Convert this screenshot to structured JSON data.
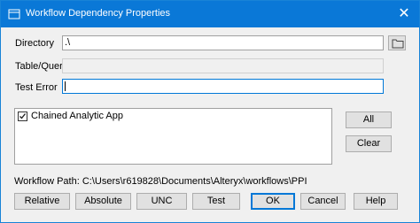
{
  "window": {
    "title": "Workflow Dependency Properties",
    "close_glyph": "✕"
  },
  "fields": {
    "directory_label": "Directory",
    "directory_value": ".\\",
    "table_query_label": "Table/Query",
    "table_query_value": "",
    "test_error_label": "Test Error",
    "test_error_value": ""
  },
  "list": {
    "items": [
      {
        "label": "Chained Analytic App",
        "checked": true
      }
    ]
  },
  "side_buttons": {
    "all_label": "All",
    "clear_label": "Clear"
  },
  "workflow_path": {
    "text": "Workflow Path: C:\\Users\\r619828\\Documents\\Alteryx\\workflows\\PPI"
  },
  "bottom_buttons": {
    "relative": "Relative",
    "absolute": "Absolute",
    "unc": "UNC",
    "test": "Test",
    "ok": "OK",
    "cancel": "Cancel",
    "help": "Help"
  },
  "colors": {
    "titlebar": "#0a78d7",
    "dialog_bg": "#f0f0f0",
    "accent": "#0078d7"
  },
  "icons": {
    "title": "dependency-icon",
    "folder": "folder-icon",
    "close": "close-icon",
    "check": "checkmark-icon"
  }
}
